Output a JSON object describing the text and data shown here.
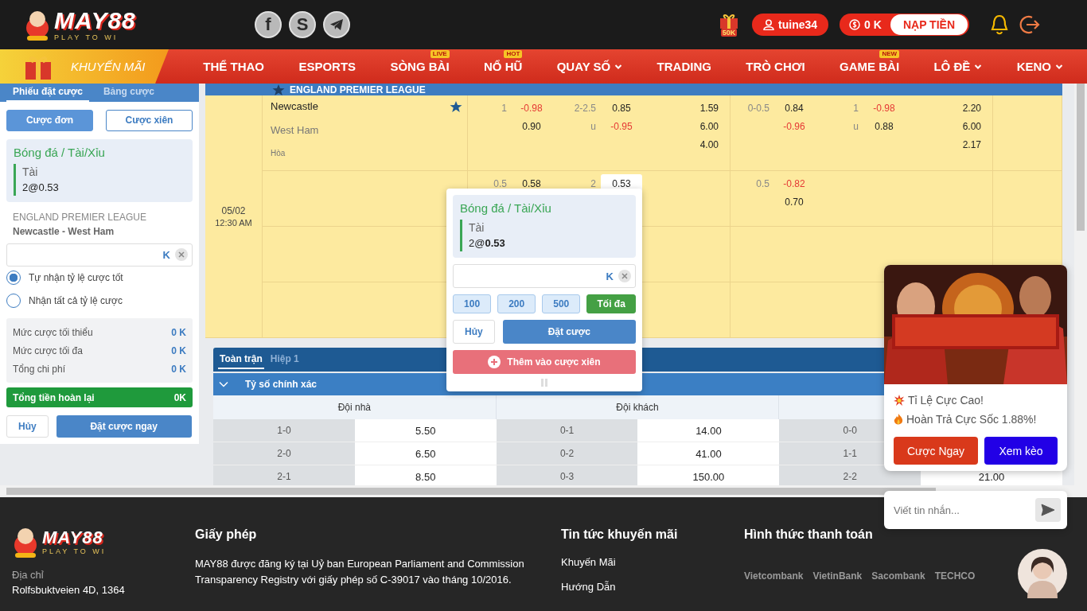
{
  "header": {
    "logo": {
      "name": "MAY88",
      "tagline": "PLAY TO WI"
    },
    "social": [
      {
        "kind": "facebook",
        "glyph": "f"
      },
      {
        "kind": "skype",
        "glyph": "S"
      },
      {
        "kind": "telegram"
      }
    ],
    "gift_badge": "50K",
    "user": "tuine34",
    "balance": "0 K",
    "deposit": "NẠP TIỀN"
  },
  "nav": [
    {
      "label": "KHUYẾN MÃI",
      "kind": "promo",
      "dropdown": false
    },
    {
      "label": "THỂ THAO",
      "kind": "link",
      "dropdown": false
    },
    {
      "label": "ESPORTS",
      "kind": "link",
      "dropdown": false
    },
    {
      "label": "SÒNG BÀI",
      "kind": "link",
      "dropdown": false,
      "badge": "LIVE"
    },
    {
      "label": "NỔ HŨ",
      "kind": "link",
      "dropdown": false,
      "badge": "HOT"
    },
    {
      "label": "QUAY SỐ",
      "kind": "link",
      "dropdown": true
    },
    {
      "label": "TRADING",
      "kind": "link",
      "dropdown": false
    },
    {
      "label": "TRÒ CHƠI",
      "kind": "link",
      "dropdown": false
    },
    {
      "label": "GAME BÀI",
      "kind": "link",
      "dropdown": false,
      "badge": "NEW"
    },
    {
      "label": "LÔ ĐỀ",
      "kind": "link",
      "dropdown": true
    },
    {
      "label": "KENO",
      "kind": "link",
      "dropdown": true
    }
  ],
  "bet_slip": {
    "tabs": [
      {
        "label": "Phiếu đặt cược",
        "selected": true
      },
      {
        "label": "Bảng cược",
        "selected": false
      }
    ],
    "modes": [
      {
        "label": "Cược đơn",
        "selected": true
      },
      {
        "label": "Cược xiên",
        "selected": false
      }
    ],
    "selection": {
      "market": "Bóng đá / Tài/Xỉu",
      "pick": "Tài",
      "price": "2@0.53"
    },
    "league": "ENGLAND PREMIER LEAGUE",
    "match": "Newcastle - West Ham",
    "unit": "K",
    "odds_options": [
      {
        "label": "Tự nhận tỷ lệ cược tốt",
        "selected": true
      },
      {
        "label": "Nhận tất cả tỷ lệ cược",
        "selected": false
      }
    ],
    "limits": [
      {
        "label": "Mức cược tối thiểu",
        "value": "0 K"
      },
      {
        "label": "Mức cược tối đa",
        "value": "0 K"
      },
      {
        "label": "Tổng chi phí",
        "value": "0 K"
      }
    ],
    "payout": {
      "label": "Tổng tiền hoàn lại",
      "value": "0K"
    },
    "cancel": "Hủy",
    "submit": "Đặt cược ngay"
  },
  "league": {
    "name": "ENGLAND PREMIER LEAGUE",
    "favorite": true
  },
  "match": {
    "date": "05/02",
    "time": "12:30 AM",
    "home": "Newcastle",
    "away": "West Ham",
    "draw": "Hòa",
    "favorite": true,
    "rows": [
      {
        "groups": [
          [
            {
              "handicap": "1",
              "handicap_odds": {
                "odds": "-0.98",
                "color": "#e53935",
                "selected": false
              },
              "total": "2-2.5",
              "total_odds": {
                "odds": "0.85",
                "color": "#222222",
                "selected": false
              },
              "result_odds": {
                "odds": "1.59",
                "color": "#222222",
                "selected": false
              }
            },
            {
              "handicap_odds": {
                "odds": "0.90",
                "color": "#222222",
                "selected": false
              },
              "total": "u",
              "total_odds": {
                "odds": "-0.95",
                "color": "#e53935",
                "selected": false
              },
              "result_odds": {
                "odds": "6.00",
                "color": "#222222",
                "selected": false
              }
            },
            {
              "result_odds": {
                "odds": "4.00",
                "color": "#222222",
                "selected": false
              }
            }
          ],
          [
            {
              "handicap": "0-0.5",
              "handicap_odds": {
                "odds": "0.84",
                "color": "#222222",
                "selected": false
              },
              "total": "1",
              "total_odds": {
                "odds": "-0.98",
                "color": "#e53935",
                "selected": false
              },
              "result_odds": {
                "odds": "2.20",
                "color": "#222222",
                "selected": false
              }
            },
            {
              "handicap_odds": {
                "odds": "-0.96",
                "color": "#e53935",
                "selected": false
              },
              "total": "u",
              "total_odds": {
                "odds": "0.88",
                "color": "#222222",
                "selected": false
              },
              "result_odds": {
                "odds": "6.00",
                "color": "#222222",
                "selected": false
              }
            },
            {
              "result_odds": {
                "odds": "2.17",
                "color": "#222222",
                "selected": false
              }
            }
          ]
        ]
      },
      {
        "groups": [
          [
            {
              "handicap": "0.5",
              "handicap_odds": {
                "odds": "0.58",
                "color": "#222222",
                "selected": false
              },
              "total": "2",
              "total_odds": {
                "odds": "0.53",
                "color": "#222222",
                "selected": true
              }
            }
          ],
          [
            {
              "handicap": "0.5",
              "handicap_odds": {
                "odds": "-0.82",
                "color": "#e53935",
                "selected": false
              }
            },
            {
              "handicap_odds": {
                "odds": "0.70",
                "color": "#222222",
                "selected": false
              }
            }
          ]
        ]
      }
    ]
  },
  "markets": {
    "tabs": [
      {
        "label": "Toàn trận",
        "selected": true
      },
      {
        "label": "Hiệp 1",
        "selected": false
      }
    ],
    "title": "Tỷ số chính xác",
    "expanded": true,
    "columns": [
      "Đội nhà",
      "Đội khách"
    ],
    "rows": [
      [
        [
          "1-0",
          "5.50"
        ],
        [
          "0-1",
          "14.00"
        ],
        [
          "0-0"
        ]
      ],
      [
        [
          "2-0",
          "6.50"
        ],
        [
          "0-2",
          "41.00"
        ],
        [
          "1-1"
        ]
      ],
      [
        [
          "2-1",
          "8.50"
        ],
        [
          "0-3",
          "150.00"
        ],
        [
          "2-2",
          "21.00"
        ]
      ]
    ]
  },
  "quick_bet": {
    "market": "Bóng đá / Tài/Xỉu",
    "pick": "Tài",
    "price": "2@**0.53**",
    "unit": "K",
    "amounts": [
      "100",
      "200",
      "500"
    ],
    "max": "Tối đa",
    "cancel": "Hủy",
    "submit": "Đặt cược",
    "parlay": "Thêm vào cược xiên"
  },
  "promo": {
    "lines": [
      {
        "kind": "boom",
        "text": "Tỉ Lệ Cực Cao!"
      },
      {
        "kind": "fire",
        "text": "Hoàn Trả Cực Sốc 1.88%!"
      }
    ],
    "buttons": [
      {
        "label": "Cược Ngay",
        "color": "#d9391b"
      },
      {
        "label": "Xem kèo",
        "color": "#2200e6"
      }
    ]
  },
  "chat": {
    "placeholder": "Viết tin nhắn..."
  },
  "footer": {
    "logo": {
      "name": "MAY88",
      "tagline": "PLAY TO WI"
    },
    "address_label": "Địa chỉ",
    "address": "Rolfsbuktveien 4D, 1364",
    "license": {
      "title": "Giấy phép",
      "text": "MAY88 được đăng ký tại Uỷ ban European Parliament and Commission Transparency Registry với giấy phép số C-39017 vào tháng 10/2016."
    },
    "news": {
      "title": "Tin tức khuyến mãi",
      "links": [
        "Khuyến Mãi",
        "Hướng Dẫn"
      ]
    },
    "payments": {
      "title": "Hình thức thanh toán",
      "banks": [
        "Vietcombank",
        "VietinBank",
        "Sacombank",
        "TECHCO"
      ]
    }
  }
}
